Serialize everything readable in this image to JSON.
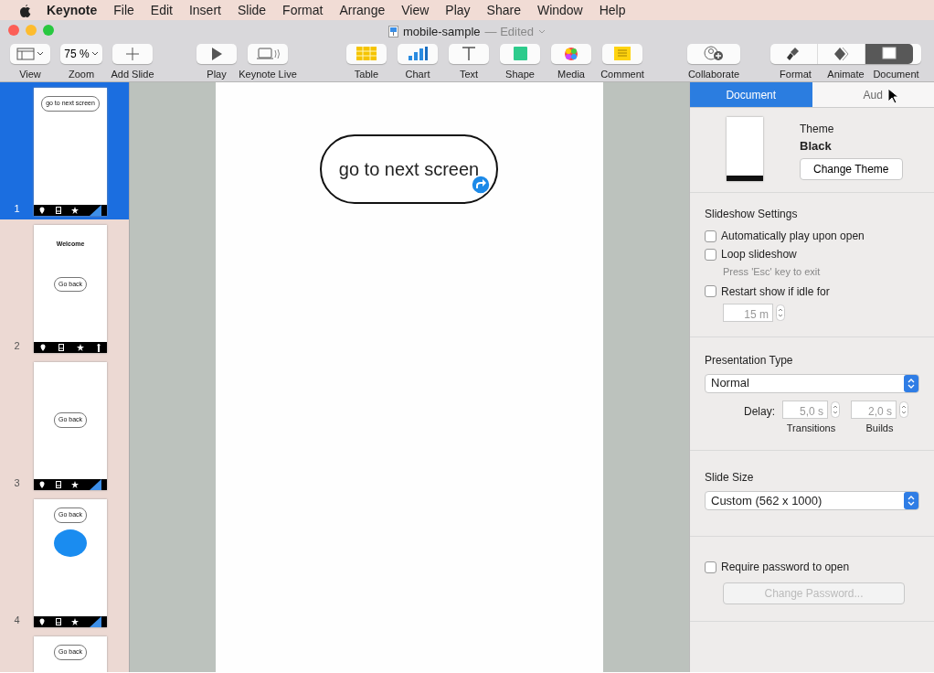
{
  "menu_bar": {
    "app": "Keynote",
    "items": [
      "File",
      "Edit",
      "Insert",
      "Slide",
      "Format",
      "Arrange",
      "View",
      "Play",
      "Share",
      "Window",
      "Help"
    ]
  },
  "window": {
    "title": "mobile-sample",
    "status": "— Edited"
  },
  "toolbar": {
    "groups": [
      [
        {
          "label": "View"
        },
        {
          "label": "Zoom",
          "value": "75 %"
        },
        {
          "label": "Add Slide"
        }
      ],
      [
        {
          "label": "Play"
        },
        {
          "label": "Keynote Live"
        }
      ],
      [
        {
          "label": "Table"
        },
        {
          "label": "Chart"
        },
        {
          "label": "Text"
        },
        {
          "label": "Shape"
        },
        {
          "label": "Media"
        },
        {
          "label": "Comment"
        }
      ],
      [
        {
          "label": "Collaborate"
        }
      ]
    ],
    "modes": [
      {
        "label": "Format",
        "selected": false
      },
      {
        "label": "Animate",
        "selected": false
      },
      {
        "label": "Document",
        "selected": true
      }
    ]
  },
  "slides": [
    {
      "number": "1",
      "selected": true,
      "button": "go to next screen",
      "curl": true
    },
    {
      "number": "2",
      "selected": false,
      "heading": "Welcome",
      "button": "Go back",
      "curl": false
    },
    {
      "number": "3",
      "selected": false,
      "button": "Go back",
      "curl": true
    },
    {
      "number": "4",
      "selected": false,
      "button": "Go back",
      "circle": true,
      "curl": true
    },
    {
      "selected": false,
      "button": "Go back"
    }
  ],
  "canvas": {
    "button": "go to next screen",
    "linked": true
  },
  "inspector": {
    "tabs": [
      {
        "label": "Document",
        "selected": true
      },
      {
        "label": "Aud",
        "selected": false
      }
    ],
    "theme": {
      "label": "Theme",
      "name": "Black",
      "button": "Change Theme"
    },
    "slideshow": {
      "heading": "Slideshow Settings",
      "options": [
        {
          "label": "Automatically play upon open",
          "checked": false
        },
        {
          "label": "Loop slideshow",
          "checked": false,
          "hint": "Press 'Esc' key to exit"
        },
        {
          "label": "Restart show if idle for",
          "checked": false,
          "stepper": {
            "value": "15 m",
            "disabled": true
          }
        }
      ]
    },
    "presentation_type": {
      "heading": "Presentation Type",
      "value": "Normal",
      "delay_label": "Delay:",
      "delays": [
        {
          "value": "5,0 s",
          "caption": "Transitions",
          "disabled": true
        },
        {
          "value": "2,0 s",
          "caption": "Builds",
          "disabled": true
        }
      ]
    },
    "slide_size": {
      "heading": "Slide Size",
      "value": "Custom (562 x 1000)"
    },
    "password": {
      "label": "Require password to open",
      "checked": false,
      "button": "Change Password...",
      "disabled": true
    }
  }
}
